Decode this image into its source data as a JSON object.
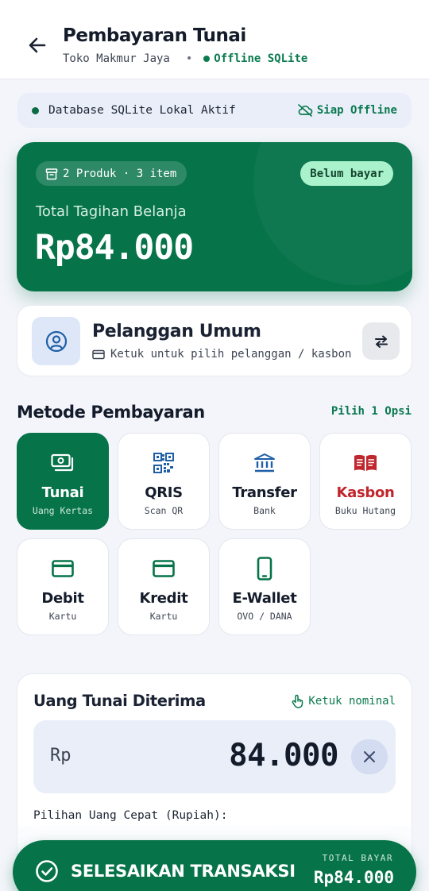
{
  "header": {
    "title": "Pembayaran Tunai",
    "store_name": "Toko Makmur Jaya",
    "separator": "•",
    "status": "Offline SQLite"
  },
  "db_bar": {
    "label": "Database SQLite Lokal Aktif",
    "offline_label": "Siap Offline"
  },
  "total_card": {
    "product_chip": "2 Produk · 3 item",
    "status_badge": "Belum bayar",
    "label": "Total Tagihan Belanja",
    "amount": "Rp84.000"
  },
  "customer": {
    "name": "Pelanggan Umum",
    "hint": "Ketuk untuk pilih pelanggan / kasbon"
  },
  "payment_methods": {
    "title": "Metode Pembayaran",
    "hint": "Pilih 1 Opsi",
    "items": [
      {
        "label": "Tunai",
        "sub": "Uang Kertas",
        "icon": "cash-icon"
      },
      {
        "label": "QRIS",
        "sub": "Scan QR",
        "icon": "qr-code-icon"
      },
      {
        "label": "Transfer",
        "sub": "Bank",
        "icon": "bank-icon"
      },
      {
        "label": "Kasbon",
        "sub": "Buku Hutang",
        "icon": "book-icon"
      },
      {
        "label": "Debit",
        "sub": "Kartu",
        "icon": "card-icon"
      },
      {
        "label": "Kredit",
        "sub": "Kartu",
        "icon": "card-icon"
      },
      {
        "label": "E-Wallet",
        "sub": "OVO / DANA",
        "icon": "phone-icon"
      }
    ],
    "selected": "Tunai"
  },
  "cash": {
    "title": "Uang Tunai Diterima",
    "tap_hint": "Ketuk nominal",
    "prefix": "Rp",
    "value": "84.000",
    "quick_label": "Pilihan Uang Cepat (Rupiah):"
  },
  "finish": {
    "label": "SELESAIKAN TRANSAKSI",
    "total_label": "TOTAL BAYAR",
    "total": "Rp84.000"
  },
  "colors": {
    "primary": "#067349",
    "accent_text": "#0b7a4f",
    "kasbon": "#c0262d",
    "transfer": "#1f5fa8",
    "badge_bg": "#a6f2c9"
  }
}
